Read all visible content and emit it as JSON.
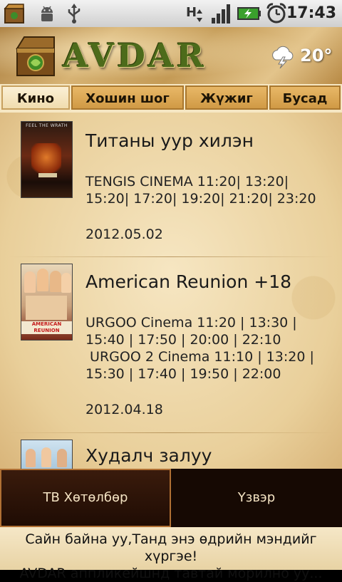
{
  "status_bar": {
    "time": "17:43",
    "icons": [
      "app-box-icon",
      "android-debug-icon",
      "usb-icon",
      "hspa-signal-icon",
      "signal-bars-icon",
      "battery-charging-icon",
      "alarm-clock-icon"
    ]
  },
  "header": {
    "logo_text": "AVDAR",
    "weather_icon": "storm-cloud-icon",
    "temperature": "20°"
  },
  "tabs": [
    {
      "label": "Кино",
      "active": true
    },
    {
      "label": "Хошин шог",
      "active": false
    },
    {
      "label": "Жүжиг",
      "active": false
    },
    {
      "label": "Бусад",
      "active": false
    }
  ],
  "movies": [
    {
      "title": "Титаны уур хилэн",
      "schedule": "TENGIS CINEMA 11:20| 13:20|\n15:20| 17:20| 19:20| 21:20| 23:20",
      "date": "2012.05.02",
      "poster_caption": "FEEL THE WRATH"
    },
    {
      "title": "American Reunion +18",
      "schedule": "URGOO Cinema 11:20 | 13:30 |\n15:40 | 17:50 | 20:00 | 22:10\n URGOO 2 Cinema 11:10 | 13:20 |\n15:30 | 17:40 | 19:50 | 22:00",
      "date": "2012.04.18",
      "poster_caption": "AMERICAN REUNION"
    },
    {
      "title": "Худалч залуу",
      "schedule": "",
      "date": ""
    }
  ],
  "bottom_buttons": {
    "tv_label": "ТВ Хөтөлбөр",
    "exchange_label": "Үзвэр"
  },
  "ticker": {
    "line1": "Сайн байна уу,Танд энэ өдрийн мэндийг хүргэе!",
    "line2": "AVDAR аппликейшнд тавтай морилно уу..."
  },
  "colors": {
    "tab_active": "#f0dcae",
    "tab_inactive": "#d09a45",
    "button_bg": "#1f0c04",
    "ticker_bg": "#f5e7c7"
  }
}
